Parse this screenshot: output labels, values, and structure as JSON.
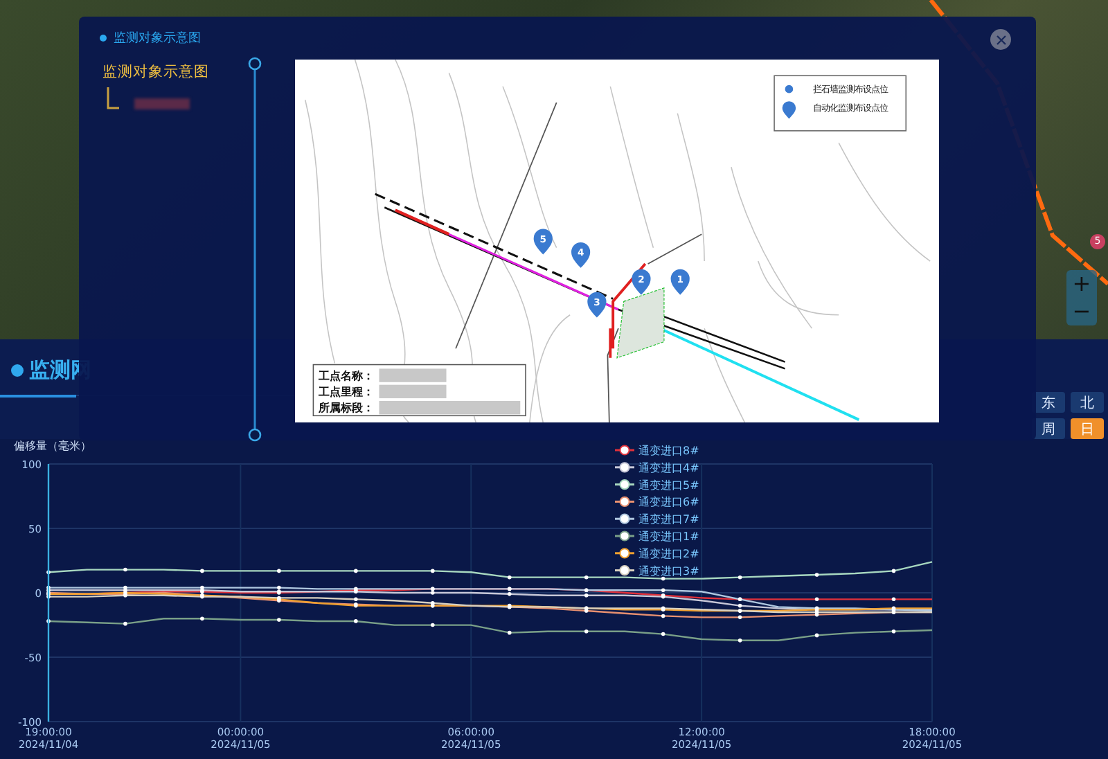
{
  "map": {
    "marker": "5",
    "zoom_controls": [
      "+",
      "−"
    ]
  },
  "panel": {
    "title": "监测网",
    "direction_buttons": [
      {
        "label": "东",
        "selected": false
      },
      {
        "label": "北",
        "selected": false
      }
    ],
    "period_buttons": [
      {
        "label": "周",
        "selected": false
      },
      {
        "label": "日",
        "selected": true
      }
    ],
    "chart_data": {
      "type": "line",
      "ylabel": "偏移量（毫米）",
      "categories": [
        "19:00:00 2024/11/04",
        null,
        null,
        null,
        null,
        "00:00:00 2024/11/05",
        null,
        null,
        null,
        null,
        null,
        "06:00:00 2024/11/05",
        null,
        null,
        null,
        null,
        null,
        "12:00:00 2024/11/05",
        null,
        null,
        null,
        null,
        null,
        "18:00:00 2024/11/05"
      ],
      "ylim": [
        -100,
        100
      ],
      "yticks": [
        -100,
        -50,
        0,
        50,
        100
      ],
      "grid": true,
      "legend": "top",
      "series": [
        {
          "name": "通变进口8#",
          "color": "#e0303a",
          "values": [
            -1,
            -1,
            0,
            1,
            1,
            0,
            0,
            1,
            2,
            2,
            3,
            3,
            3,
            3,
            2,
            0,
            -2,
            -4,
            -5,
            -5,
            -5,
            -5,
            -5,
            -5
          ]
        },
        {
          "name": "通变进口4#",
          "color": "#c8c8d8",
          "values": [
            2,
            2,
            2,
            2,
            2,
            1,
            1,
            1,
            1,
            0,
            0,
            0,
            -1,
            -2,
            -2,
            -2,
            -3,
            -6,
            -10,
            -12,
            -13,
            -13,
            -13,
            -13
          ]
        },
        {
          "name": "通变进口5#",
          "color": "#a8d8c0",
          "values": [
            16,
            18,
            18,
            18,
            17,
            17,
            17,
            17,
            17,
            17,
            17,
            16,
            12,
            12,
            12,
            12,
            11,
            11,
            12,
            13,
            14,
            15,
            17,
            24
          ]
        },
        {
          "name": "通变进口6#",
          "color": "#e89070",
          "values": [
            0,
            -1,
            -1,
            0,
            -2,
            -4,
            -6,
            -8,
            -9,
            -10,
            -10,
            -10,
            -11,
            -12,
            -14,
            -16,
            -18,
            -19,
            -19,
            -18,
            -17,
            -16,
            -15,
            -15
          ]
        },
        {
          "name": "通变进口7#",
          "color": "#b0c8e0",
          "values": [
            4,
            4,
            4,
            4,
            4,
            4,
            4,
            3,
            3,
            3,
            3,
            3,
            3,
            3,
            2,
            2,
            2,
            1,
            -5,
            -11,
            -12,
            -12,
            -13,
            -14
          ]
        },
        {
          "name": "通变进口1#",
          "color": "#7aa088",
          "values": [
            -22,
            -23,
            -24,
            -20,
            -20,
            -21,
            -21,
            -22,
            -22,
            -25,
            -25,
            -25,
            -31,
            -30,
            -30,
            -30,
            -32,
            -36,
            -37,
            -37,
            -33,
            -31,
            -30,
            -29
          ]
        },
        {
          "name": "通变进口2#",
          "color": "#f0a030",
          "values": [
            -1,
            -1,
            0,
            -1,
            -2,
            -3,
            -5,
            -8,
            -10,
            -10,
            -10,
            -10,
            -10,
            -11,
            -12,
            -13,
            -13,
            -14,
            -14,
            -14,
            -13,
            -13,
            -12,
            -12
          ]
        },
        {
          "name": "通变进口3#",
          "color": "#d8d0c0",
          "values": [
            -3,
            -3,
            -2,
            -2,
            -3,
            -3,
            -4,
            -4,
            -5,
            -6,
            -8,
            -10,
            -11,
            -11,
            -12,
            -12,
            -12,
            -13,
            -14,
            -15,
            -15,
            -15,
            -15,
            -15
          ]
        }
      ]
    }
  },
  "modal": {
    "title": "监测对象示意图",
    "tree": {
      "label": "监测对象示意图"
    },
    "diagram": {
      "legend": [
        {
          "kind": "dot",
          "label": "拦石墙监测布设点位"
        },
        {
          "kind": "pin",
          "label": "自动化监测布设点位"
        }
      ],
      "info_labels": [
        "工点名称：",
        "工点里程：",
        "所属标段："
      ],
      "markers": [
        "1",
        "2",
        "3",
        "4",
        "5"
      ]
    }
  }
}
